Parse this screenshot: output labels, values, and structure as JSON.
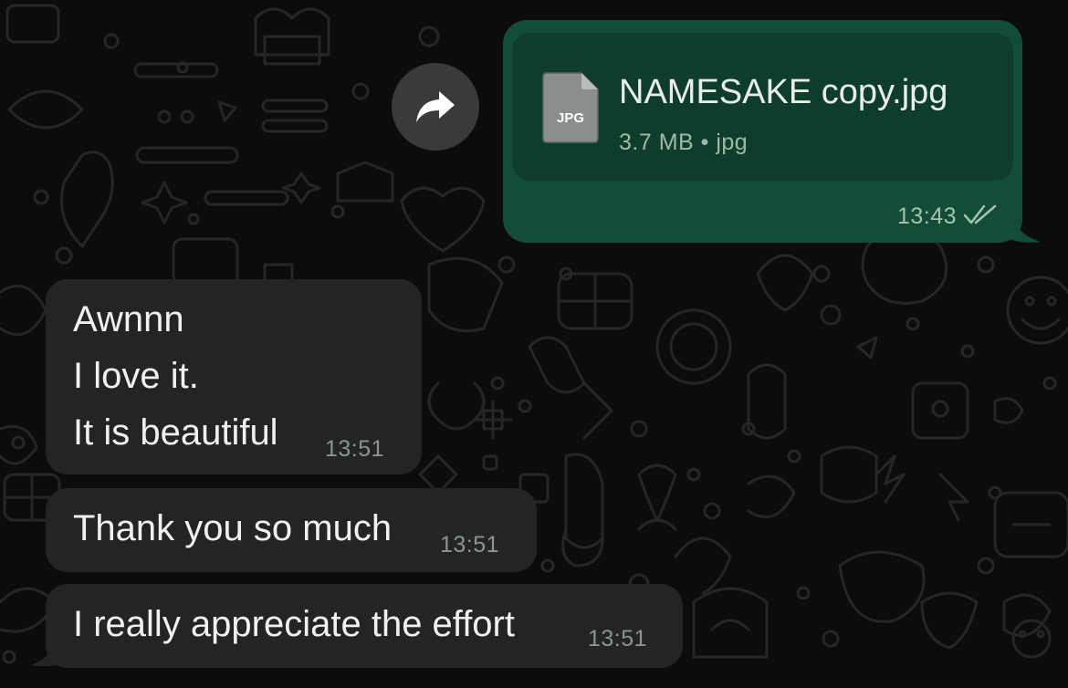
{
  "chat": {
    "forward_icon": "forward-arrow-icon",
    "outgoing": {
      "file_type_icon": "jpg-file-icon",
      "file_type_label": "JPG",
      "file_name": "NAMESAKE copy.jpg",
      "file_meta": "3.7 MB • jpg",
      "time": "13:43",
      "status_icon": "double-check-icon"
    },
    "incoming": [
      {
        "lines": [
          "Awnnn",
          "I love it.",
          "It is beautiful"
        ],
        "time": "13:51"
      },
      {
        "lines": [
          "Thank you so much"
        ],
        "time": "13:51"
      },
      {
        "lines": [
          "I really appreciate the effort"
        ],
        "time": "13:51"
      }
    ]
  },
  "colors": {
    "background": "#0c0c0c",
    "outgoing_bubble": "#134d37",
    "file_card": "#0f3d2c",
    "incoming_bubble": "#232524",
    "text_primary": "#f0f0f0"
  }
}
